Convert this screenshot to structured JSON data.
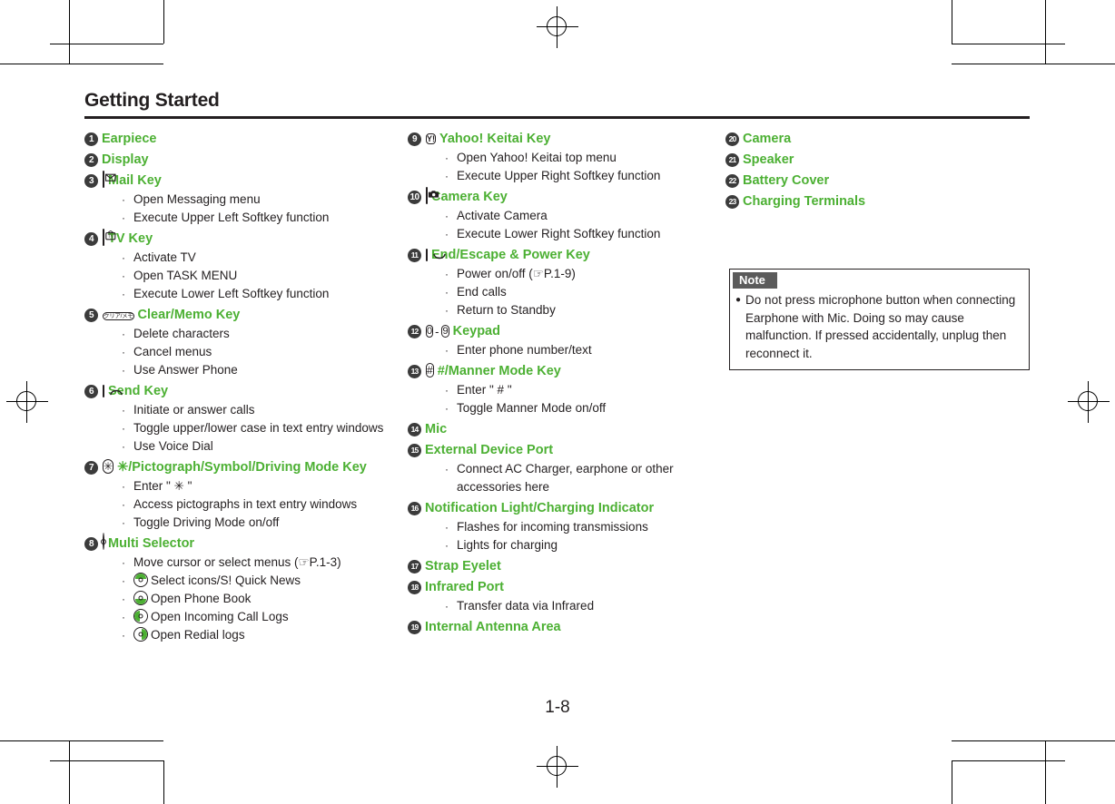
{
  "page": {
    "title": "Getting Started",
    "folio": "1-8"
  },
  "note": {
    "heading": "Note",
    "bullet": "●",
    "text": "Do not press microphone button when connecting Earphone with Mic. Doing so may cause malfunction. If pressed accidentally, unplug then reconnect it."
  },
  "columns": [
    {
      "id": "column-left",
      "entries": [
        {
          "num": "❶",
          "number": "1",
          "title": "Earpiece",
          "icon": null,
          "items": []
        },
        {
          "num": "❷",
          "number": "2",
          "title": "Display",
          "icon": null,
          "items": []
        },
        {
          "num": "❸",
          "number": "3",
          "title": "Mail Key",
          "icon": "mail-key-icon",
          "items": [
            "Open Messaging menu",
            "Execute Upper Left Softkey function"
          ]
        },
        {
          "num": "❹",
          "number": "4",
          "title": "TV Key",
          "icon": "tv-key-icon",
          "items": [
            "Activate TV",
            "Open TASK MENU",
            "Execute Lower Left Softkey function"
          ]
        },
        {
          "num": "❺",
          "number": "5",
          "title": "Clear/Memo Key",
          "icon": "clear-memo-key-icon",
          "icon_label": "クリア/メモ",
          "items": [
            "Delete characters",
            "Cancel menus",
            "Use Answer Phone"
          ]
        },
        {
          "num": "❻",
          "number": "6",
          "title": "Send Key",
          "icon": "send-key-icon",
          "items": [
            "Initiate or answer calls",
            "Toggle upper/lower case in text entry windows",
            "Use Voice Dial"
          ]
        },
        {
          "num": "❼",
          "number": "7",
          "title": "✳/Pictograph/Symbol/Driving Mode Key",
          "icon": "star-key-icon",
          "icon_label": "✳",
          "items": [
            "Enter \" ✳ \"",
            "Access pictographs in text entry windows",
            "Toggle Driving Mode on/off"
          ]
        },
        {
          "num": "❽",
          "number": "8",
          "title": "Multi Selector",
          "icon": "multi-selector-icon",
          "items": [
            "Move cursor or select menus (☞P.1-3)",
            "Select icons/S! Quick News",
            "Open Phone Book",
            "Open Incoming Call Logs",
            "Open Redial logs"
          ]
        }
      ]
    },
    {
      "id": "column-middle",
      "entries": [
        {
          "num": "❾",
          "number": "9",
          "title": "Yahoo! Keitai Key",
          "icon": "yahoo-keitai-key-icon",
          "icon_label": "Y!",
          "items": [
            "Open Yahoo! Keitai top menu",
            "Execute Upper Right Softkey function"
          ]
        },
        {
          "num": "❿",
          "number": "10",
          "title": "Camera Key",
          "icon": "camera-key-icon",
          "items": [
            "Activate Camera",
            "Execute Lower Right Softkey function"
          ]
        },
        {
          "num": "⓫",
          "number": "11",
          "title": "End/Escape & Power Key",
          "icon": "end-power-key-icon",
          "items": [
            "Power on/off (☞P.1-9)",
            "End calls",
            "Return to Standby"
          ]
        },
        {
          "num": "⓬",
          "number": "12",
          "title": "Keypad",
          "icon": "keypad-icon",
          "icon_label_from": "0",
          "icon_label_to": "9",
          "items": [
            "Enter phone number/text"
          ]
        },
        {
          "num": "⓭",
          "number": "13",
          "title": "#/Manner Mode Key",
          "icon": "hash-key-icon",
          "icon_label": "#",
          "items": [
            "Enter \" # \"",
            "Toggle Manner Mode on/off"
          ]
        },
        {
          "num": "⓮",
          "number": "14",
          "title": "Mic",
          "icon": null,
          "items": []
        },
        {
          "num": "⓯",
          "number": "15",
          "title": "External Device Port",
          "icon": null,
          "items": [
            "Connect AC Charger, earphone or other accessories here"
          ]
        },
        {
          "num": "⓰",
          "number": "16",
          "title": "Notification Light/Charging Indicator",
          "icon": null,
          "items": [
            "Flashes for incoming transmissions",
            "Lights for charging"
          ]
        },
        {
          "num": "⓱",
          "number": "17",
          "title": "Strap Eyelet",
          "icon": null,
          "items": []
        },
        {
          "num": "⓲",
          "number": "18",
          "title": "Infrared Port",
          "icon": null,
          "items": [
            "Transfer data via Infrared"
          ]
        },
        {
          "num": "⓳",
          "number": "19",
          "title": "Internal Antenna Area",
          "icon": null,
          "items": []
        }
      ]
    },
    {
      "id": "column-right",
      "entries": [
        {
          "num": "⓴",
          "number": "20",
          "title": "Camera",
          "icon": null,
          "items": []
        },
        {
          "num": "⓵",
          "number": "21",
          "title": "Speaker",
          "icon": null,
          "items": []
        },
        {
          "num": "⓶",
          "number": "22",
          "title": "Battery Cover",
          "icon": null,
          "items": []
        },
        {
          "num": "⓷",
          "number": "23",
          "title": "Charging Terminals",
          "icon": null,
          "items": []
        }
      ]
    }
  ],
  "colors": {
    "accent_green": "#4cb033",
    "text": "#231f20",
    "badge": "#3b3b3b",
    "note_head": "#5b5b5b"
  }
}
